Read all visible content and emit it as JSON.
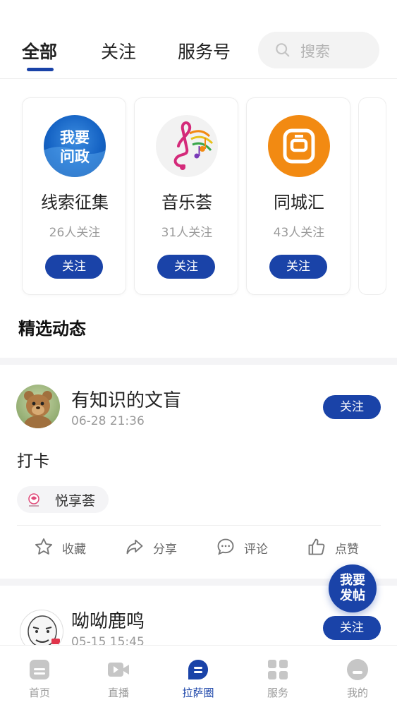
{
  "top_tabs": [
    {
      "label": "全部",
      "active": true
    },
    {
      "label": "关注",
      "active": false
    },
    {
      "label": "服务号",
      "active": false
    }
  ],
  "search": {
    "placeholder": "搜索"
  },
  "services": [
    {
      "logo_text": [
        "我要",
        "问政"
      ],
      "name": "线索征集",
      "followers": "26人关注",
      "button": "关注"
    },
    {
      "name": "音乐荟",
      "followers": "31人关注",
      "button": "关注"
    },
    {
      "logo_text": [
        "同"
      ],
      "name": "同城汇",
      "followers": "43人关注",
      "button": "关注"
    }
  ],
  "section_title": "精选动态",
  "posts": [
    {
      "user": "有知识的文盲",
      "time": "06-28 21:36",
      "follow": "关注",
      "text": "打卡",
      "tag": "悦享荟",
      "actions": [
        "收藏",
        "分享",
        "评论",
        "点赞"
      ]
    },
    {
      "user": "呦呦鹿鸣",
      "time": "05-15 15:45",
      "follow": "关注"
    }
  ],
  "fab": {
    "line1": "我要",
    "line2": "发帖"
  },
  "bottom_nav": [
    {
      "label": "首页",
      "icon": "home-icon",
      "active": false
    },
    {
      "label": "直播",
      "icon": "live-icon",
      "active": false
    },
    {
      "label": "拉萨圈",
      "icon": "circle-chat-icon",
      "active": true
    },
    {
      "label": "服务",
      "icon": "grid-icon",
      "active": false
    },
    {
      "label": "我的",
      "icon": "profile-icon",
      "active": false
    }
  ],
  "colors": {
    "accent": "#1a43a8",
    "muted": "#9a9a9a",
    "orange": "#f28a12"
  }
}
